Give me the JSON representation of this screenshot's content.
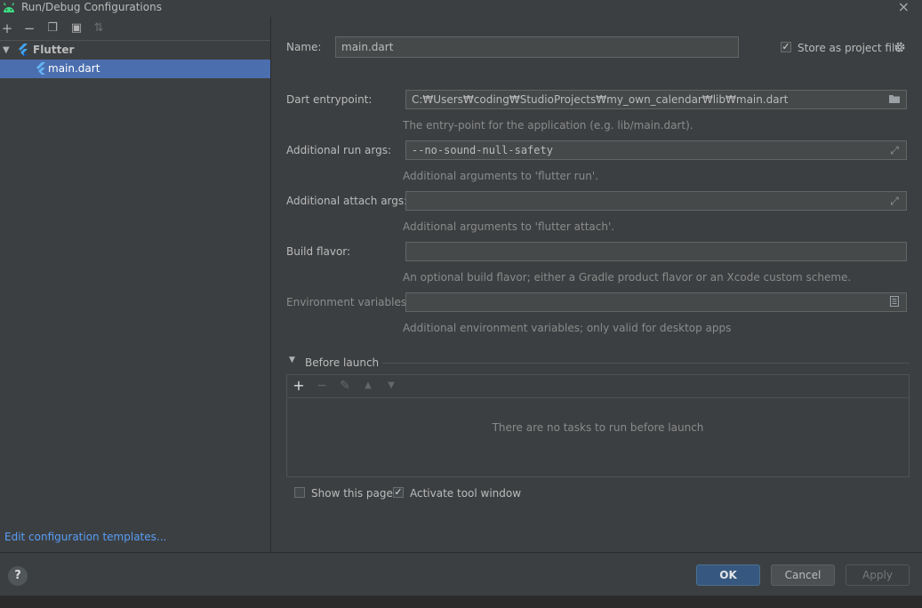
{
  "window": {
    "title": "Run/Debug Configurations",
    "close_icon": "×"
  },
  "toolbar": {
    "add_icon": "+",
    "remove_icon": "−",
    "copy_icon": "❐",
    "folder_icon": "▣",
    "sort_icon": "⇅"
  },
  "tree": {
    "group_label": "Flutter",
    "config_label": "main.dart"
  },
  "left_footer": {
    "edit_templates": "Edit configuration templates..."
  },
  "form": {
    "name_label": "Name:",
    "name_value": "main.dart",
    "store_label": "Store as project file",
    "store_checked": "✓",
    "entrypoint_label": "Dart entrypoint:",
    "entrypoint_value": "C:₩Users₩coding₩StudioProjects₩my_own_calendar₩lib₩main.dart",
    "entrypoint_hint": "The entry-point for the application (e.g. lib/main.dart).",
    "run_args_label": "Additional run args:",
    "run_args_value": "--no-sound-null-safety",
    "run_args_hint": "Additional arguments to 'flutter run'.",
    "attach_args_label": "Additional attach args:",
    "attach_args_value": "",
    "attach_args_hint": "Additional arguments to 'flutter attach'.",
    "flavor_label": "Build flavor:",
    "flavor_value": "",
    "flavor_hint": "An optional build flavor; either a Gradle product flavor or an Xcode custom scheme.",
    "env_label": "Environment variables:",
    "env_value": "",
    "env_hint": "Additional environment variables; only valid for desktop apps"
  },
  "before_launch": {
    "title": "Before launch",
    "add_icon": "+",
    "remove_icon": "−",
    "edit_icon": "✎",
    "up_icon": "▲",
    "down_icon": "▼",
    "empty_text": "There are no tasks to run before launch",
    "show_page_label": "Show this page",
    "activate_label": "Activate tool window",
    "activate_checked": "✓"
  },
  "buttons": {
    "help": "?",
    "ok": "OK",
    "cancel": "Cancel",
    "apply": "Apply"
  }
}
